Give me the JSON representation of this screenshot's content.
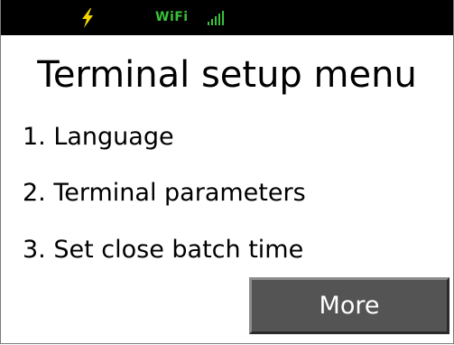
{
  "status_bar": {
    "charging_icon": "lightning-bolt-icon",
    "wifi_label": "WiFi",
    "signal_icon": "signal-strength-icon",
    "colors": {
      "background": "#000000",
      "bolt": "#f2d300",
      "wifi": "#39c23a"
    }
  },
  "screen": {
    "title": "Terminal setup menu",
    "menu_items": [
      {
        "label": "1. Language"
      },
      {
        "label": "2. Terminal parameters"
      },
      {
        "label": "3. Set close batch time"
      }
    ],
    "more_button_label": "More",
    "colors": {
      "background": "#ffffff",
      "text": "#000000",
      "button_background": "#545454",
      "button_text": "#ffffff"
    }
  }
}
